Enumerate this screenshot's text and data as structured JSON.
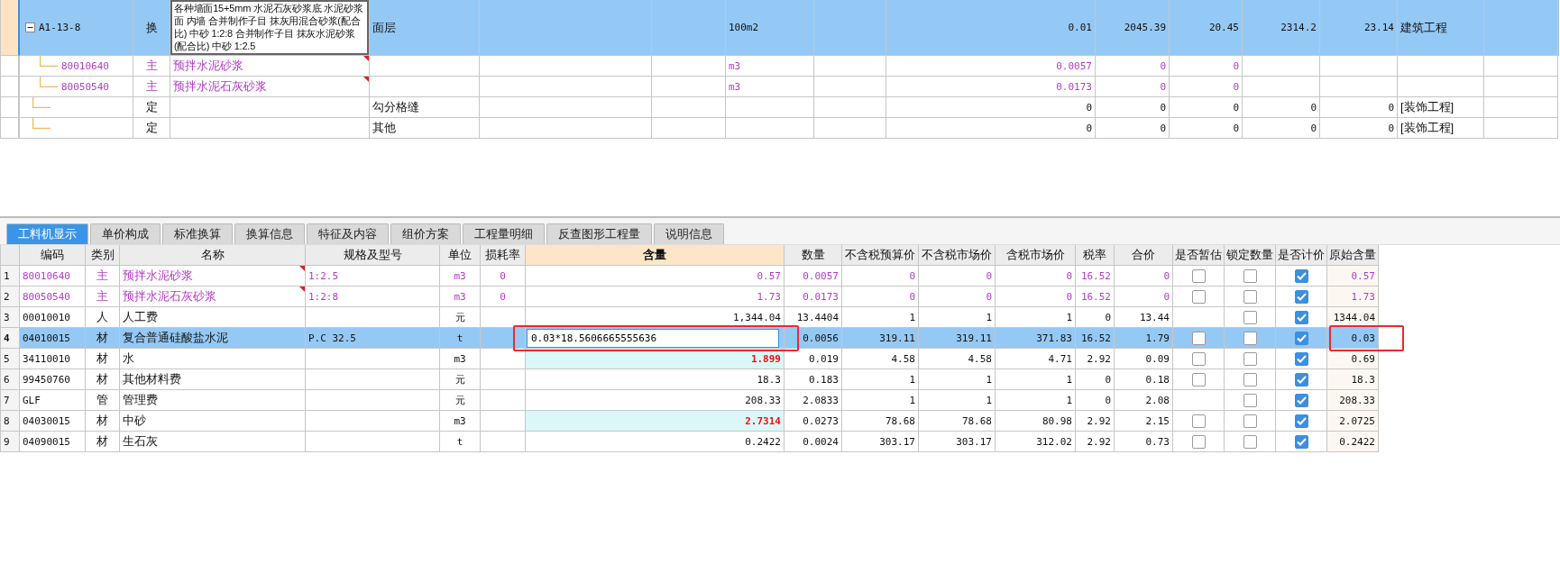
{
  "upper_table": {
    "rows": [
      {
        "selected": true,
        "kind": "item",
        "code": "A1-13-8",
        "expanded": true,
        "type": "换",
        "name": "各种墙面15+5mm 水泥石灰砂浆底 水泥砂浆面 内墙  合并制作子目 抹灰用混合砂浆(配合比) 中砂 1:2:8  合并制作子目 抹灰水泥砂浆(配合比) 中砂 1:2.5",
        "name_popup": true,
        "column_4": "面层",
        "column_7": "100m2",
        "column_9": "0.01",
        "column_10": "2045.39",
        "column_11": "20.45",
        "column_12": "2314.2",
        "column_13": "23.14",
        "column_14": "建筑工程",
        "children": [
          {
            "selected": false,
            "kind": "main",
            "code": "80010640",
            "type": "主",
            "name": "预拌水泥砂浆",
            "has_note": true,
            "column_7": "m3",
            "column_9": "0.0057",
            "column_10": "0",
            "column_11": "0"
          },
          {
            "selected": false,
            "kind": "main",
            "code": "80050540",
            "type": "主",
            "name": "预拌水泥石灰砂浆",
            "has_note": true,
            "column_7": "m3",
            "column_9": "0.0173",
            "column_10": "0",
            "column_11": "0"
          }
        ]
      },
      {
        "selected": false,
        "kind": "item",
        "type": "定",
        "column_4": "勾分格缝",
        "column_9": "0",
        "column_10": "0",
        "column_11": "0",
        "column_12": "0",
        "column_13": "0",
        "column_14": "[装饰工程]"
      },
      {
        "selected": false,
        "kind": "item",
        "type": "定",
        "column_4": "其他",
        "column_9": "0",
        "column_10": "0",
        "column_11": "0",
        "column_12": "0",
        "column_13": "0",
        "column_14": "[装饰工程]"
      }
    ]
  },
  "tabs": [
    {
      "label": "工料机显示",
      "selected": true
    },
    {
      "label": "单价构成",
      "selected": false
    },
    {
      "label": "标准换算",
      "selected": false
    },
    {
      "label": "换算信息",
      "selected": false
    },
    {
      "label": "特征及内容",
      "selected": false
    },
    {
      "label": "组价方案",
      "selected": false
    },
    {
      "label": "工程量明细",
      "selected": false
    },
    {
      "label": "反查图形工程量",
      "selected": false
    },
    {
      "label": "说明信息",
      "selected": false
    }
  ],
  "lower_table": {
    "columns": [
      {
        "label": "编码",
        "selected": false
      },
      {
        "label": "类别",
        "selected": false
      },
      {
        "label": "名称",
        "selected": false
      },
      {
        "label": "规格及型号",
        "selected": false
      },
      {
        "label": "单位",
        "selected": false
      },
      {
        "label": "损耗率",
        "selected": false
      },
      {
        "label": "含量",
        "selected": true
      },
      {
        "label": "数量",
        "selected": false
      },
      {
        "label": "不含税预算价",
        "selected": false
      },
      {
        "label": "不含税市场价",
        "selected": false
      },
      {
        "label": "含税市场价",
        "selected": false
      },
      {
        "label": "税率",
        "selected": false
      },
      {
        "label": "合价",
        "selected": false
      },
      {
        "label": "是否暂估",
        "selected": false
      },
      {
        "label": "锁定数量",
        "selected": false
      },
      {
        "label": "是否计价",
        "selected": false
      },
      {
        "label": "原始含量",
        "selected": false
      }
    ],
    "rows": [
      {
        "number": "1",
        "selected": false,
        "kind": "main",
        "code": "80010640",
        "type": "主",
        "name": "预拌水泥砂浆",
        "has_note": true,
        "spec": "1:2.5",
        "unit": "m3",
        "loss": "0",
        "content": "0.57",
        "quantity": "0.0057",
        "budget_price": "0",
        "market_price": "0",
        "tax_market_price": "0",
        "tax_rate": "16.52",
        "total": "0",
        "estimate": false,
        "locked": false,
        "priced": true,
        "original_content": "0.57"
      },
      {
        "number": "2",
        "selected": false,
        "kind": "main",
        "code": "80050540",
        "type": "主",
        "name": "预拌水泥石灰砂浆",
        "has_note": true,
        "spec": "1:2:8",
        "unit": "m3",
        "loss": "0",
        "content": "1.73",
        "quantity": "0.0173",
        "budget_price": "0",
        "market_price": "0",
        "tax_market_price": "0",
        "tax_rate": "16.52",
        "total": "0",
        "estimate": false,
        "locked": false,
        "priced": true,
        "original_content": "1.73"
      },
      {
        "number": "3",
        "selected": false,
        "kind": "plain",
        "code": "00010010",
        "type": "人",
        "name": "人工费",
        "unit": "元",
        "content": "1,344.04",
        "quantity": "13.4404",
        "budget_price": "1",
        "market_price": "1",
        "tax_market_price": "1",
        "tax_rate": "0",
        "total": "13.44",
        "locked": false,
        "priced": true,
        "original_content": "1344.04"
      },
      {
        "number": "4",
        "selected": true,
        "kind": "plain",
        "code": "04010015",
        "type": "材",
        "name": "复合普通硅酸盐水泥",
        "spec": "P.C 32.5",
        "unit": "t",
        "content": "0.03*18.5606665555636",
        "editing": true,
        "marked_content": true,
        "quantity": "0.0056",
        "budget_price": "319.11",
        "market_price": "319.11",
        "tax_market_price": "371.83",
        "tax_rate": "16.52",
        "total": "1.79",
        "estimate": false,
        "locked": false,
        "priced": true,
        "original_content": "0.03",
        "marked_original": true
      },
      {
        "number": "5",
        "selected": false,
        "kind": "plain",
        "code": "34110010",
        "type": "材",
        "name": "水",
        "unit": "m3",
        "content": "1.899",
        "modified": true,
        "quantity": "0.019",
        "budget_price": "4.58",
        "market_price": "4.58",
        "tax_market_price": "4.71",
        "tax_rate": "2.92",
        "total": "0.09",
        "estimate": false,
        "locked": false,
        "priced": true,
        "original_content": "0.69"
      },
      {
        "number": "6",
        "selected": false,
        "kind": "plain",
        "code": "99450760",
        "type": "材",
        "name": "其他材料费",
        "unit": "元",
        "content": "18.3",
        "quantity": "0.183",
        "budget_price": "1",
        "market_price": "1",
        "tax_market_price": "1",
        "tax_rate": "0",
        "total": "0.18",
        "estimate": false,
        "locked": false,
        "priced": true,
        "original_content": "18.3"
      },
      {
        "number": "7",
        "selected": false,
        "kind": "plain",
        "code": "GLF",
        "type": "管",
        "name": "管理费",
        "unit": "元",
        "content": "208.33",
        "quantity": "2.0833",
        "budget_price": "1",
        "market_price": "1",
        "tax_market_price": "1",
        "tax_rate": "0",
        "total": "2.08",
        "locked": false,
        "priced": true,
        "original_content": "208.33"
      },
      {
        "number": "8",
        "selected": false,
        "kind": "plain",
        "code": "04030015",
        "type": "材",
        "name": "中砂",
        "unit": "m3",
        "content": "2.7314",
        "modified": true,
        "quantity": "0.0273",
        "budget_price": "78.68",
        "market_price": "78.68",
        "tax_market_price": "80.98",
        "tax_rate": "2.92",
        "total": "2.15",
        "estimate": false,
        "locked": false,
        "priced": true,
        "original_content": "2.0725"
      },
      {
        "number": "9",
        "selected": false,
        "kind": "plain",
        "code": "04090015",
        "type": "材",
        "name": "生石灰",
        "unit": "t",
        "content": "0.2422",
        "quantity": "0.0024",
        "budget_price": "303.17",
        "market_price": "303.17",
        "tax_market_price": "312.02",
        "tax_rate": "2.92",
        "total": "0.73",
        "estimate": false,
        "locked": false,
        "priced": true,
        "original_content": "0.2422"
      }
    ]
  }
}
